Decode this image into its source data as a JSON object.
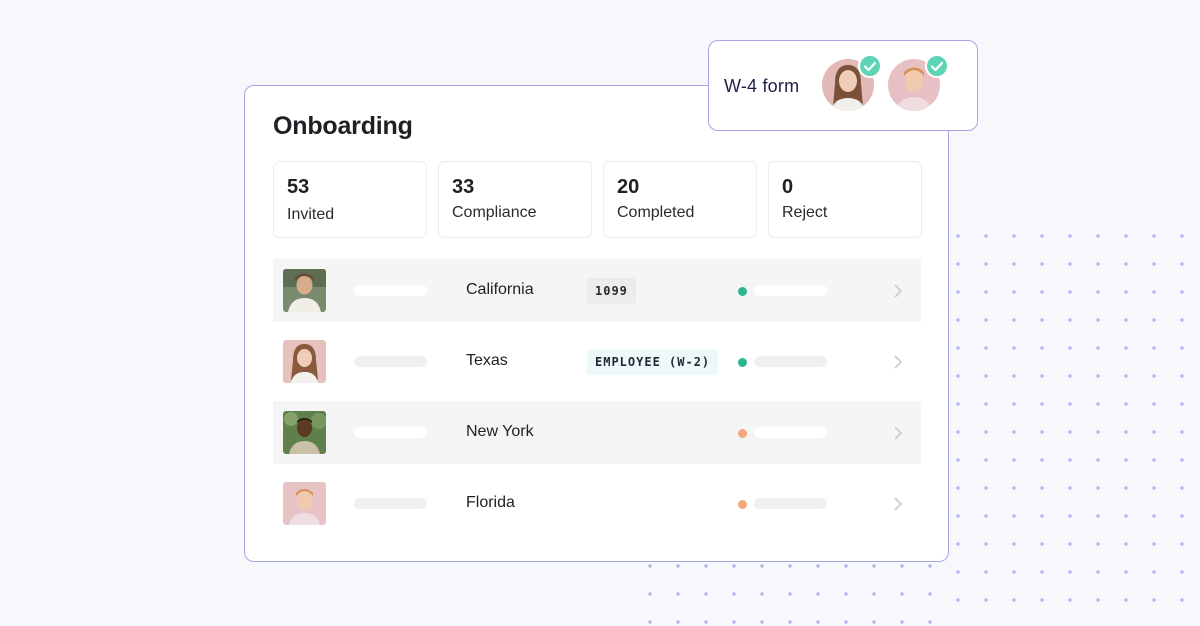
{
  "onboarding": {
    "title": "Onboarding",
    "stats": [
      {
        "value": "53",
        "label": "Invited"
      },
      {
        "value": "33",
        "label": "Compliance"
      },
      {
        "value": "20",
        "label": "Completed"
      },
      {
        "value": "0",
        "label": "Reject"
      }
    ],
    "rows": [
      {
        "state": "California",
        "badge": "1099",
        "status_color": "#2bb78f"
      },
      {
        "state": "Texas",
        "badge": "EMPLOYEE (W-2)",
        "status_color": "#2bb78f"
      },
      {
        "state": "New York",
        "badge": "",
        "status_color": "#f4a97a"
      },
      {
        "state": "Florida",
        "badge": "",
        "status_color": "#f4a97a"
      }
    ]
  },
  "popup": {
    "label": "W-4 form"
  },
  "colors": {
    "accent_border": "#a9a6e6",
    "check_green": "#5fd3b5",
    "status_green": "#2bb78f",
    "status_orange": "#f4a97a"
  },
  "icons": [
    "check-icon",
    "chevron-right-icon"
  ]
}
